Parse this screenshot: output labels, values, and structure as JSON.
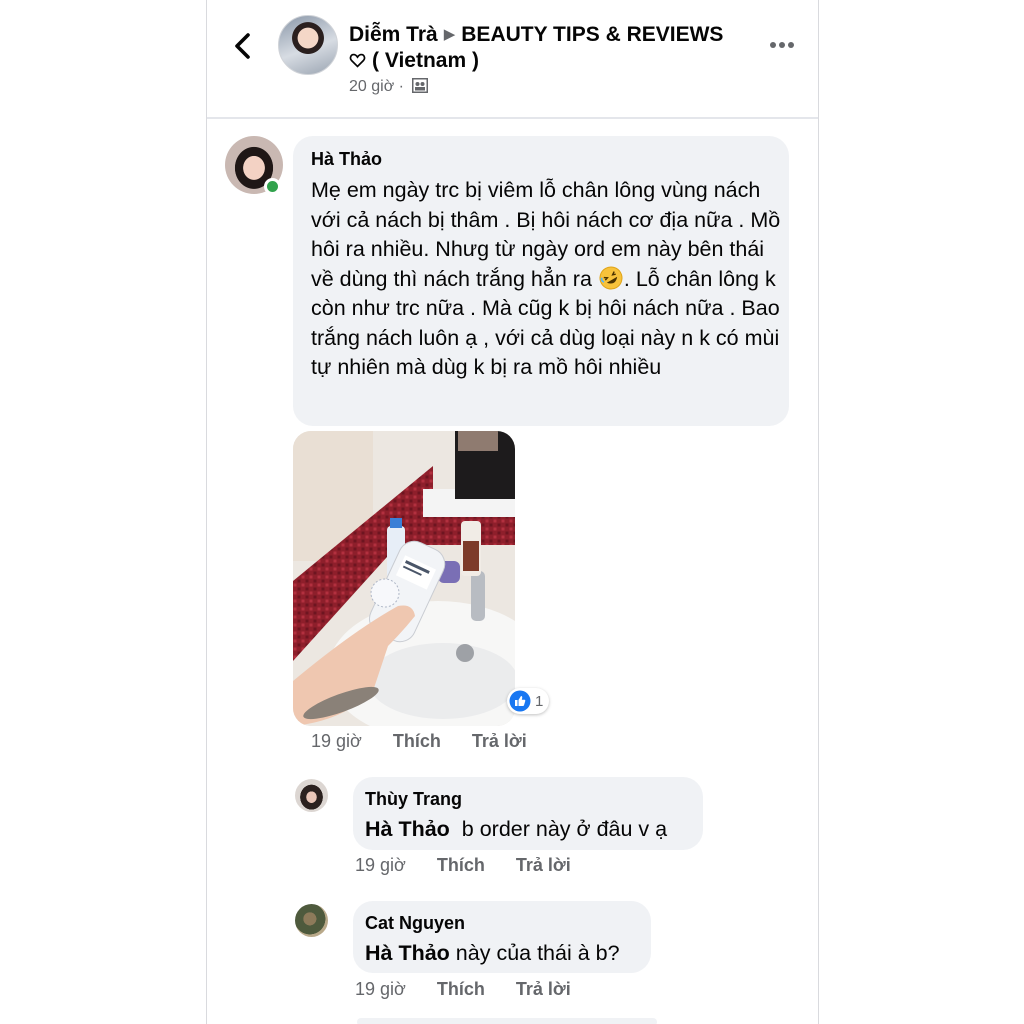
{
  "header": {
    "author": "Diễm Trà",
    "arrow": "▶",
    "group": "BEAUTY TIPS & REVIEWS",
    "group_suffix": "( Vietnam )",
    "time": "20 giờ ·",
    "icons": [
      "back-chevron-icon",
      "heart-outline-icon",
      "group-privacy-icon",
      "more-dots-icon"
    ]
  },
  "main_comment": {
    "author": "Hà Thảo",
    "text_part1": "Mẹ em ngày trc bị viêm lỗ chân lông vùng nách với cả nách bị thâm . Bị hôi nách cơ địa nữa . Mồ hôi ra nhiều. Nhưg từ ngày ord em này bên thái về dùng thì nách trắng hẳn ra",
    "emoji": "rolling-on-floor-laughing-emoji",
    "text_part2": ". Lỗ chân lông k còn như trc nữa . Mà cũg k bị hôi nách nữa . Bao trắng nách luôn ạ , với cả dùg loại này n k có mùi tự nhiên mà dùg k bị ra mồ hôi nhiều",
    "photo": "photo of deodorant bottle held over bathroom sink",
    "reaction_count": "1",
    "time": "19 giờ",
    "like": "Thích",
    "reply": "Trả lời",
    "online": true
  },
  "replies": [
    {
      "author": "Thùy Trang",
      "mention": "Hà Thảo",
      "text": "  b order này ở đâu v ạ",
      "time": "19 giờ",
      "like": "Thích",
      "reply": "Trả lời"
    },
    {
      "author": "Cat Nguyen",
      "mention": "Hà Thảo",
      "text": " này của thái à b?",
      "time": "19 giờ",
      "like": "Thích",
      "reply": "Trả lời"
    }
  ],
  "colors": {
    "bubble": "#f0f2f5",
    "secondary_text": "#65676b",
    "online": "#31a24c",
    "like_blue": "#1877f2"
  }
}
